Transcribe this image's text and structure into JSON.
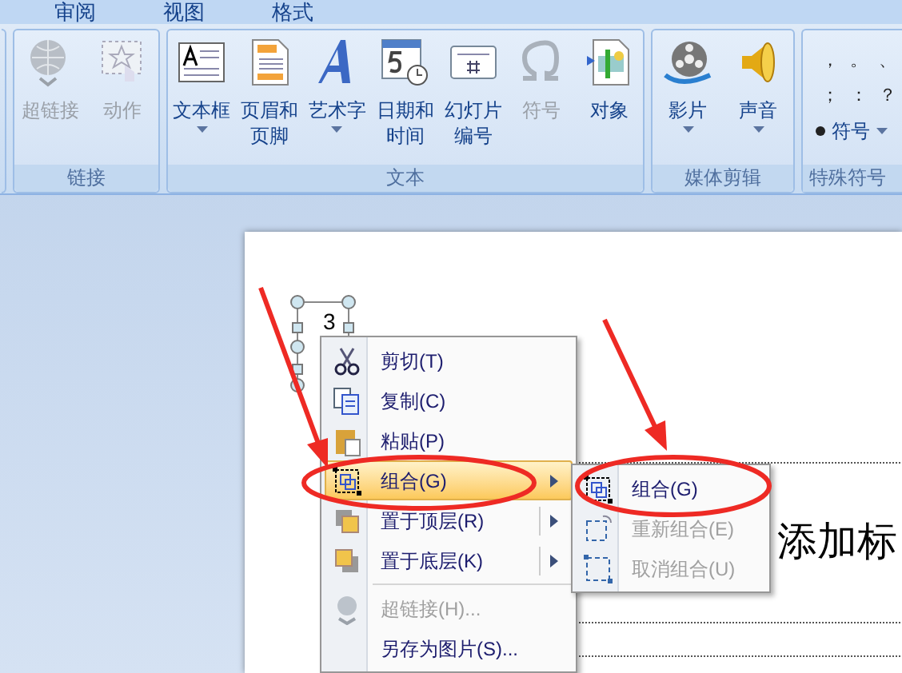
{
  "tabs": [
    {
      "label": "审阅",
      "selected": false
    },
    {
      "label": "视图",
      "selected": false
    },
    {
      "label": "格式",
      "selected": false
    }
  ],
  "ribbon_groups": [
    {
      "title": "链接",
      "buttons": [
        {
          "kind": "globe",
          "lines": [
            "超链接"
          ],
          "disabled": true,
          "dropdown": false
        },
        {
          "kind": "action",
          "lines": [
            "动作"
          ],
          "disabled": true,
          "dropdown": false
        }
      ]
    },
    {
      "title": "文本",
      "buttons": [
        {
          "kind": "textbox",
          "lines": [
            "文本框"
          ],
          "disabled": false,
          "dropdown": true
        },
        {
          "kind": "header",
          "lines": [
            "页眉和",
            "页脚"
          ],
          "disabled": false,
          "dropdown": false
        },
        {
          "kind": "wordart",
          "lines": [
            "艺术字"
          ],
          "disabled": false,
          "dropdown": true
        },
        {
          "kind": "date",
          "lines": [
            "日期和",
            "时间"
          ],
          "disabled": false,
          "dropdown": false
        },
        {
          "kind": "slidenum",
          "lines": [
            "幻灯片",
            "编号"
          ],
          "disabled": false,
          "dropdown": false
        },
        {
          "kind": "omega",
          "lines": [
            "符号"
          ],
          "disabled": true,
          "dropdown": false
        },
        {
          "kind": "object",
          "lines": [
            "对象"
          ],
          "disabled": false,
          "dropdown": false
        }
      ]
    },
    {
      "title": "媒体剪辑",
      "buttons": [
        {
          "kind": "film",
          "lines": [
            "影片"
          ],
          "disabled": false,
          "dropdown": true
        },
        {
          "kind": "speaker",
          "lines": [
            "声音"
          ],
          "disabled": false,
          "dropdown": true
        }
      ]
    }
  ],
  "special_symbols": {
    "title": "特殊符号",
    "symbols": [
      "，",
      "。",
      "、",
      "；",
      "：",
      "？"
    ],
    "button": {
      "label": "符号",
      "dropdown": true
    }
  },
  "slide": {
    "shape_label": "3",
    "title_fragment": "添加标"
  },
  "context_menu": [
    {
      "kind": "cut",
      "label": "剪切(T)",
      "disabled": false,
      "highlighted": false,
      "submenu": false
    },
    {
      "kind": "copy",
      "label": "复制(C)",
      "disabled": false,
      "highlighted": false,
      "submenu": false
    },
    {
      "kind": "paste",
      "label": "粘贴(P)",
      "disabled": false,
      "highlighted": false,
      "submenu": false
    },
    {
      "kind": "group",
      "label": "组合(G)",
      "disabled": false,
      "highlighted": true,
      "submenu": true
    },
    {
      "kind": "front",
      "label": "置于顶层(R)",
      "disabled": false,
      "highlighted": false,
      "submenu": true
    },
    {
      "kind": "back",
      "label": "置于底层(K)",
      "disabled": false,
      "highlighted": false,
      "submenu": true
    },
    {
      "kind": "separator"
    },
    {
      "kind": "link",
      "label": "超链接(H)...",
      "disabled": true,
      "highlighted": false,
      "submenu": false
    },
    {
      "kind": "none",
      "label": "另存为图片(S)...",
      "disabled": false,
      "highlighted": false,
      "submenu": false
    }
  ],
  "submenu": [
    {
      "kind": "group",
      "label": "组合(G)",
      "disabled": false
    },
    {
      "kind": "regroup",
      "label": "重新组合(E)",
      "disabled": true
    },
    {
      "kind": "ungroup",
      "label": "取消组合(U)",
      "disabled": true
    }
  ]
}
